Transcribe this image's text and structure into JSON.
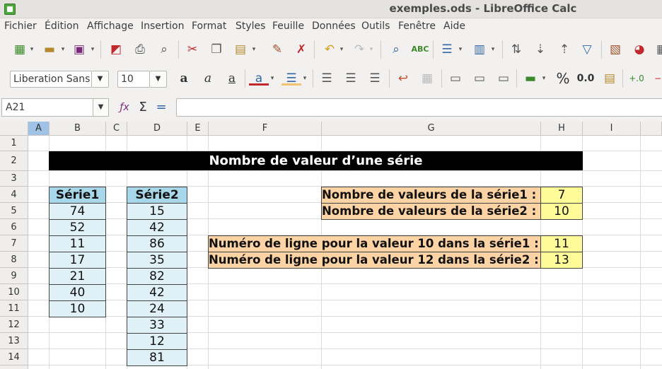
{
  "window": {
    "title": "exemples.ods - LibreOffice Calc"
  },
  "menu": [
    "Fichier",
    "Édition",
    "Affichage",
    "Insertion",
    "Format",
    "Styles",
    "Feuille",
    "Données",
    "Outils",
    "Fenêtre",
    "Aide"
  ],
  "format_bar": {
    "font_name": "Liberation Sans",
    "font_size": "10",
    "number_format_label": "0.0",
    "percent_label": "%"
  },
  "formula_bar": {
    "name_box": "A21",
    "formula": ""
  },
  "columns": [
    "A",
    "B",
    "C",
    "D",
    "E",
    "F",
    "G",
    "H",
    "I"
  ],
  "rows": [
    "1",
    "2",
    "3",
    "4",
    "5",
    "6",
    "7",
    "8",
    "9",
    "10",
    "11",
    "12",
    "13",
    "14"
  ],
  "sheet": {
    "title": "Nombre de valeur d’une série",
    "serie1_header": "Série1",
    "serie2_header": "Série2",
    "serie1": [
      "74",
      "52",
      "11",
      "17",
      "21",
      "40",
      "10"
    ],
    "serie2": [
      "15",
      "42",
      "86",
      "35",
      "82",
      "42",
      "24",
      "33",
      "12",
      "81"
    ],
    "count1_label": "Nombre de valeurs de la série1 :",
    "count1_value": "7",
    "count2_label": "Nombre de valeurs de la série2 :",
    "count2_value": "10",
    "row10_label": "Numéro de ligne pour la valeur 10 dans la série1 :",
    "row10_value": "11",
    "row12_label": "Numéro de ligne pour la valeur 12 dans la série2 :",
    "row12_value": "13"
  },
  "colors": {
    "title_bg": "#000000",
    "header_blue": "#a9d7ea",
    "cell_blue": "#dff0f7",
    "label_orange": "#fcd3a5",
    "value_yellow": "#fffb99",
    "selected_col": "#a0c2e6"
  }
}
